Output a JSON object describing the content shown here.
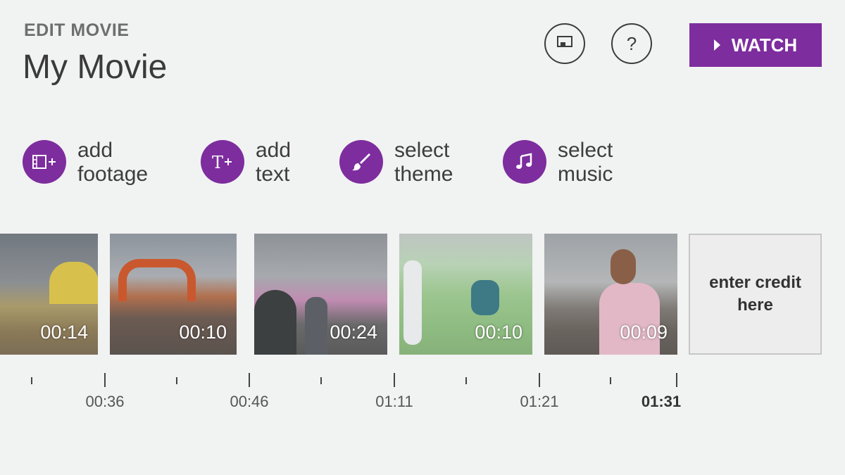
{
  "header": {
    "subtitle": "EDIT MOVIE",
    "title": "My Movie"
  },
  "toolbar": {
    "cast_icon": "cast-screen-icon",
    "help_label": "?",
    "watch_label": "WATCH"
  },
  "actions": [
    {
      "label": "add\nfootage",
      "icon": "film-add-icon"
    },
    {
      "label": "add\ntext",
      "icon": "text-add-icon"
    },
    {
      "label": "select\ntheme",
      "icon": "paintbrush-icon"
    },
    {
      "label": "select\nmusic",
      "icon": "music-note-icon"
    }
  ],
  "clips": [
    {
      "duration": "00:14"
    },
    {
      "duration": "00:10"
    },
    {
      "duration": "00:24"
    },
    {
      "duration": "00:10"
    },
    {
      "duration": "00:09"
    }
  ],
  "credit": {
    "placeholder": "enter credit\nhere"
  },
  "timeline": {
    "labels": [
      "00:36",
      "00:46",
      "01:11",
      "01:21",
      "01:31"
    ],
    "current": "01:31"
  },
  "colors": {
    "accent": "#7d2d9e",
    "background": "#f1f2f2"
  }
}
